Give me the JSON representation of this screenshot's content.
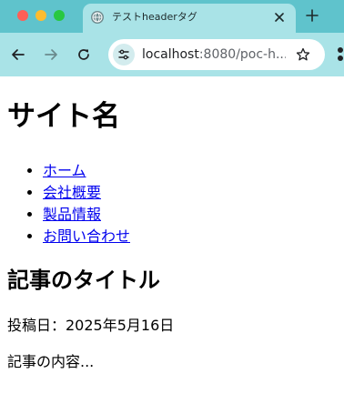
{
  "browser": {
    "tab": {
      "title": "テストheaderタグ",
      "favicon": "globe-icon"
    },
    "address_bar": {
      "host": "localhost",
      "rest": ":8080/poc-h..."
    },
    "colors": {
      "tabstrip": "#5fc3cc",
      "toolbar": "#a9e3e7",
      "link": "#0000ee"
    }
  },
  "page": {
    "site_title": "サイト名",
    "nav": [
      {
        "label": "ホーム"
      },
      {
        "label": "会社概要"
      },
      {
        "label": "製品情報"
      },
      {
        "label": "お問い合わせ"
      }
    ],
    "article": {
      "title": "記事のタイトル",
      "date": "投稿日：2025年5月16日",
      "body": "記事の内容..."
    }
  }
}
